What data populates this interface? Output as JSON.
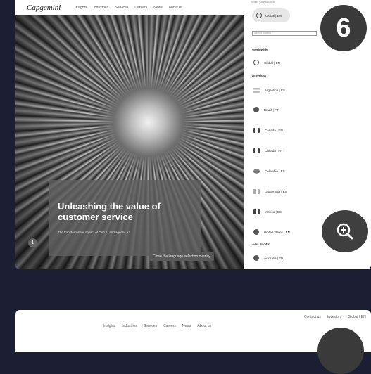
{
  "nav": {
    "logo": "Capgemini",
    "links": [
      "Insights",
      "Industries",
      "Services",
      "Careers",
      "News",
      "About us"
    ]
  },
  "hero": {
    "headline": "Unleashing the value of customer service",
    "subtext": "The transformative impact of Gen AI and agentic AI",
    "slide_number": "1"
  },
  "tooltip": "Close the language selection overlay",
  "language_panel": {
    "header": "Select your location",
    "current": "Global | EN",
    "search_placeholder": "Search location",
    "sections": [
      {
        "title": "Worldwide",
        "items": [
          "Global | EN"
        ]
      },
      {
        "title": "Americas",
        "items": [
          "Argentina | ES",
          "Brazil | PT",
          "Canada | EN",
          "Canada | FR",
          "Colombia | ES",
          "Guatemala | ES",
          "Mexico | ES",
          "United States | EN"
        ]
      },
      {
        "title": "Asia Pacific",
        "items": [
          "Australia | EN"
        ]
      }
    ]
  },
  "overlay": {
    "step_number": "6",
    "zoom_icon": "zoom-in-icon"
  },
  "second_card": {
    "nav_links": [
      "Insights",
      "Industries",
      "Services",
      "Careers",
      "News",
      "About us"
    ],
    "top_links": [
      "Contact us",
      "Investors",
      "Global | EN"
    ]
  }
}
